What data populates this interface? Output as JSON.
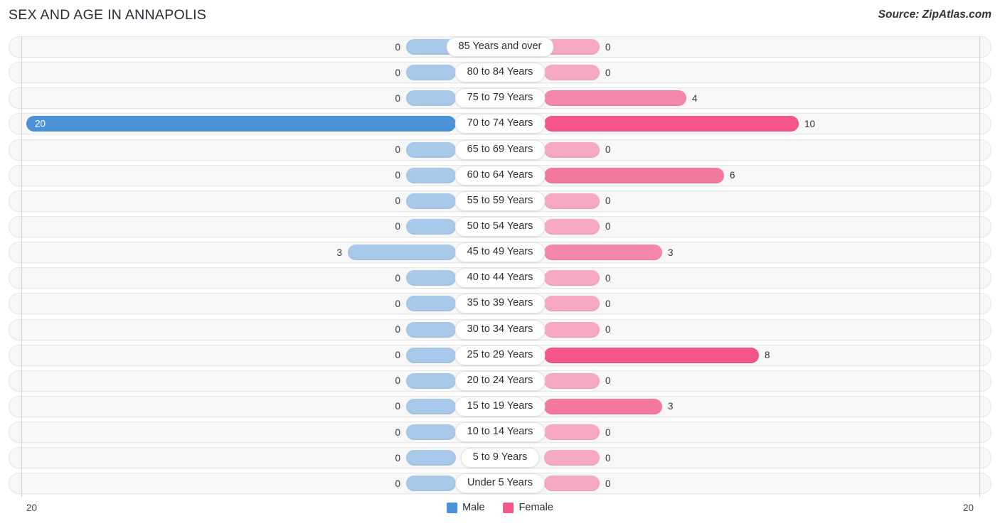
{
  "header": {
    "title": "SEX AND AGE IN ANNAPOLIS",
    "source": "Source: ZipAtlas.com"
  },
  "legend": {
    "male_label": "Male",
    "female_label": "Female",
    "male_color": "#4b92d8",
    "female_color": "#f4558b"
  },
  "axis": {
    "left_max_label": "20",
    "right_max_label": "20",
    "max": 20
  },
  "chart_data": {
    "type": "bar",
    "subtype": "population-pyramid",
    "title": "SEX AND AGE IN ANNAPOLIS",
    "xlabel": "",
    "ylabel": "",
    "xlim": [
      0,
      20
    ],
    "grid": false,
    "legend_position": "bottom-center",
    "categories": [
      "85 Years and over",
      "80 to 84 Years",
      "75 to 79 Years",
      "70 to 74 Years",
      "65 to 69 Years",
      "60 to 64 Years",
      "55 to 59 Years",
      "50 to 54 Years",
      "45 to 49 Years",
      "40 to 44 Years",
      "35 to 39 Years",
      "30 to 34 Years",
      "25 to 29 Years",
      "20 to 24 Years",
      "15 to 19 Years",
      "10 to 14 Years",
      "5 to 9 Years",
      "Under 5 Years"
    ],
    "series": [
      {
        "name": "Male",
        "color": "#4b92d8",
        "values": [
          0,
          0,
          0,
          20,
          0,
          0,
          0,
          0,
          3,
          0,
          0,
          0,
          0,
          0,
          0,
          0,
          0,
          0
        ]
      },
      {
        "name": "Female",
        "color": "#f4558b",
        "values": [
          0,
          0,
          4,
          10,
          0,
          6,
          0,
          0,
          3,
          0,
          0,
          0,
          8,
          0,
          3,
          0,
          0,
          0
        ]
      }
    ]
  },
  "rows": [
    {
      "label": "85 Years and over",
      "male": "0",
      "female": "0",
      "male_w": 70,
      "female_w": 78,
      "male_cls": "",
      "female_cls": "",
      "male_inside": false
    },
    {
      "label": "80 to 84 Years",
      "male": "0",
      "female": "0",
      "male_w": 70,
      "female_w": 78,
      "male_cls": "",
      "female_cls": "",
      "male_inside": false
    },
    {
      "label": "75 to 79 Years",
      "male": "0",
      "female": "4",
      "male_w": 70,
      "female_w": 200,
      "male_cls": "",
      "female_cls": "mid2",
      "male_inside": false
    },
    {
      "label": "70 to 74 Years",
      "male": "20",
      "female": "10",
      "male_w": 604,
      "female_w": 358,
      "male_cls": "hi",
      "female_cls": "hi",
      "male_inside": true
    },
    {
      "label": "65 to 69 Years",
      "male": "0",
      "female": "0",
      "male_w": 70,
      "female_w": 78,
      "male_cls": "",
      "female_cls": "",
      "male_inside": false
    },
    {
      "label": "60 to 64 Years",
      "male": "0",
      "female": "6",
      "male_w": 70,
      "female_w": 253,
      "male_cls": "",
      "female_cls": "mid",
      "male_inside": false
    },
    {
      "label": "55 to 59 Years",
      "male": "0",
      "female": "0",
      "male_w": 70,
      "female_w": 78,
      "male_cls": "",
      "female_cls": "",
      "male_inside": false
    },
    {
      "label": "50 to 54 Years",
      "male": "0",
      "female": "0",
      "male_w": 70,
      "female_w": 78,
      "male_cls": "",
      "female_cls": "",
      "male_inside": false
    },
    {
      "label": "45 to 49 Years",
      "male": "3",
      "female": "3",
      "male_w": 152,
      "female_w": 166,
      "male_cls": "",
      "female_cls": "mid2",
      "male_inside": false
    },
    {
      "label": "40 to 44 Years",
      "male": "0",
      "female": "0",
      "male_w": 70,
      "female_w": 78,
      "male_cls": "",
      "female_cls": "",
      "male_inside": false
    },
    {
      "label": "35 to 39 Years",
      "male": "0",
      "female": "0",
      "male_w": 70,
      "female_w": 78,
      "male_cls": "",
      "female_cls": "",
      "male_inside": false
    },
    {
      "label": "30 to 34 Years",
      "male": "0",
      "female": "0",
      "male_w": 70,
      "female_w": 78,
      "male_cls": "",
      "female_cls": "",
      "male_inside": false
    },
    {
      "label": "25 to 29 Years",
      "male": "0",
      "female": "8",
      "male_w": 70,
      "female_w": 302,
      "male_cls": "",
      "female_cls": "hi",
      "male_inside": false
    },
    {
      "label": "20 to 24 Years",
      "male": "0",
      "female": "0",
      "male_w": 70,
      "female_w": 78,
      "male_cls": "",
      "female_cls": "",
      "male_inside": false
    },
    {
      "label": "15 to 19 Years",
      "male": "0",
      "female": "3",
      "male_w": 70,
      "female_w": 166,
      "male_cls": "",
      "female_cls": "mid",
      "male_inside": false
    },
    {
      "label": "10 to 14 Years",
      "male": "0",
      "female": "0",
      "male_w": 70,
      "female_w": 78,
      "male_cls": "",
      "female_cls": "",
      "male_inside": false
    },
    {
      "label": "5 to 9 Years",
      "male": "0",
      "female": "0",
      "male_w": 70,
      "female_w": 78,
      "male_cls": "",
      "female_cls": "",
      "male_inside": false
    },
    {
      "label": "Under 5 Years",
      "male": "0",
      "female": "0",
      "male_w": 70,
      "female_w": 78,
      "male_cls": "",
      "female_cls": "",
      "male_inside": false
    }
  ]
}
